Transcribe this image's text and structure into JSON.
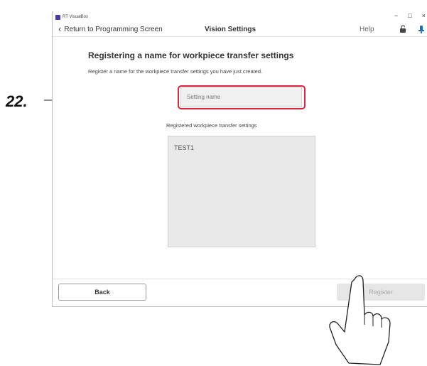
{
  "annotation": {
    "step": "22."
  },
  "window": {
    "app_title": "RT VisualBox",
    "controls": {
      "minimize": "−",
      "maximize": "□",
      "close": "×"
    }
  },
  "navbar": {
    "back_label": "Return to Programming Screen",
    "title": "Vision Settings",
    "help": "Help"
  },
  "main": {
    "heading": "Registering a name for workpiece transfer settings",
    "description": "Register a name for the workpiece transfer settings you have just created.",
    "name_input": {
      "placeholder": "Setting name",
      "value": ""
    },
    "registered_label": "Registered workpiece transfer settings",
    "registered_items": [
      "TEST1"
    ]
  },
  "footer": {
    "back_button": "Back",
    "register_button": "Register"
  },
  "colors": {
    "highlight": "#d9263a",
    "accent": "#1f6fb5"
  }
}
